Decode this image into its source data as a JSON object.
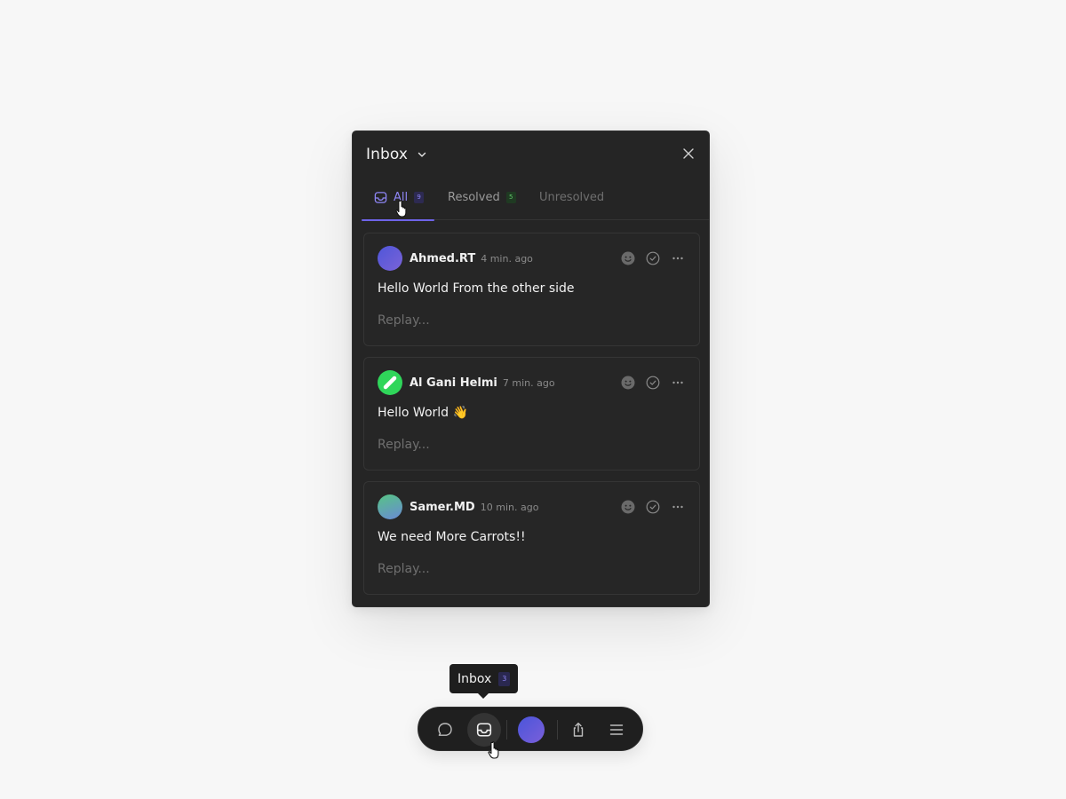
{
  "panel": {
    "title": "Inbox",
    "tabs": [
      {
        "label": "All",
        "count": "9",
        "active": true
      },
      {
        "label": "Resolved",
        "count": "5",
        "active": false
      },
      {
        "label": "Unresolved",
        "count": "",
        "active": false
      }
    ]
  },
  "comments": [
    {
      "author": "Ahmed.RT",
      "time": "4 min. ago",
      "message": "Hello World From the other side",
      "reply_placeholder": "Replay..."
    },
    {
      "author": "Al Gani Helmi",
      "time": "7 min. ago",
      "message": "Hello World 👋",
      "reply_placeholder": "Replay..."
    },
    {
      "author": "Samer.MD",
      "time": "10 min. ago",
      "message": "We need More Carrots!!",
      "reply_placeholder": "Replay..."
    }
  ],
  "tooltip": {
    "label": "Inbox",
    "count": "3"
  },
  "toolbar": {
    "items": [
      "chat-bubble-icon",
      "inbox-icon",
      "avatar",
      "share-icon",
      "menu-icon"
    ]
  },
  "colors": {
    "accent": "#6e64e8",
    "panel_bg": "#252525",
    "resolved_badge": "#5fc36a"
  }
}
